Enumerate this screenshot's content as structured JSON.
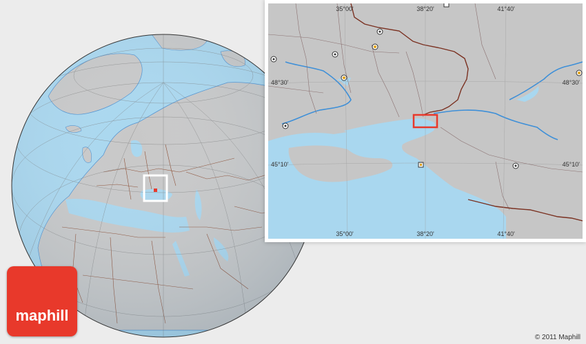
{
  "brand": {
    "logo_text": "maphill",
    "copyright": "© 2011 Maphill"
  },
  "inset": {
    "longitude_labels_top": [
      "35°00'",
      "38°20'",
      "41°40'"
    ],
    "longitude_labels_bottom": [
      "35°00'",
      "38°20'",
      "41°40'"
    ],
    "latitude_labels_left": [
      "48°30'",
      "45°10'"
    ],
    "latitude_labels_right": [
      "48°30'",
      "45°10'"
    ]
  },
  "colors": {
    "water": "#a9d7ef",
    "land": "#c8c8c8",
    "border": "#8a5a44",
    "national_border": "#8b2a1a",
    "marker": "#e8392b",
    "river": "#3d8fd8"
  }
}
